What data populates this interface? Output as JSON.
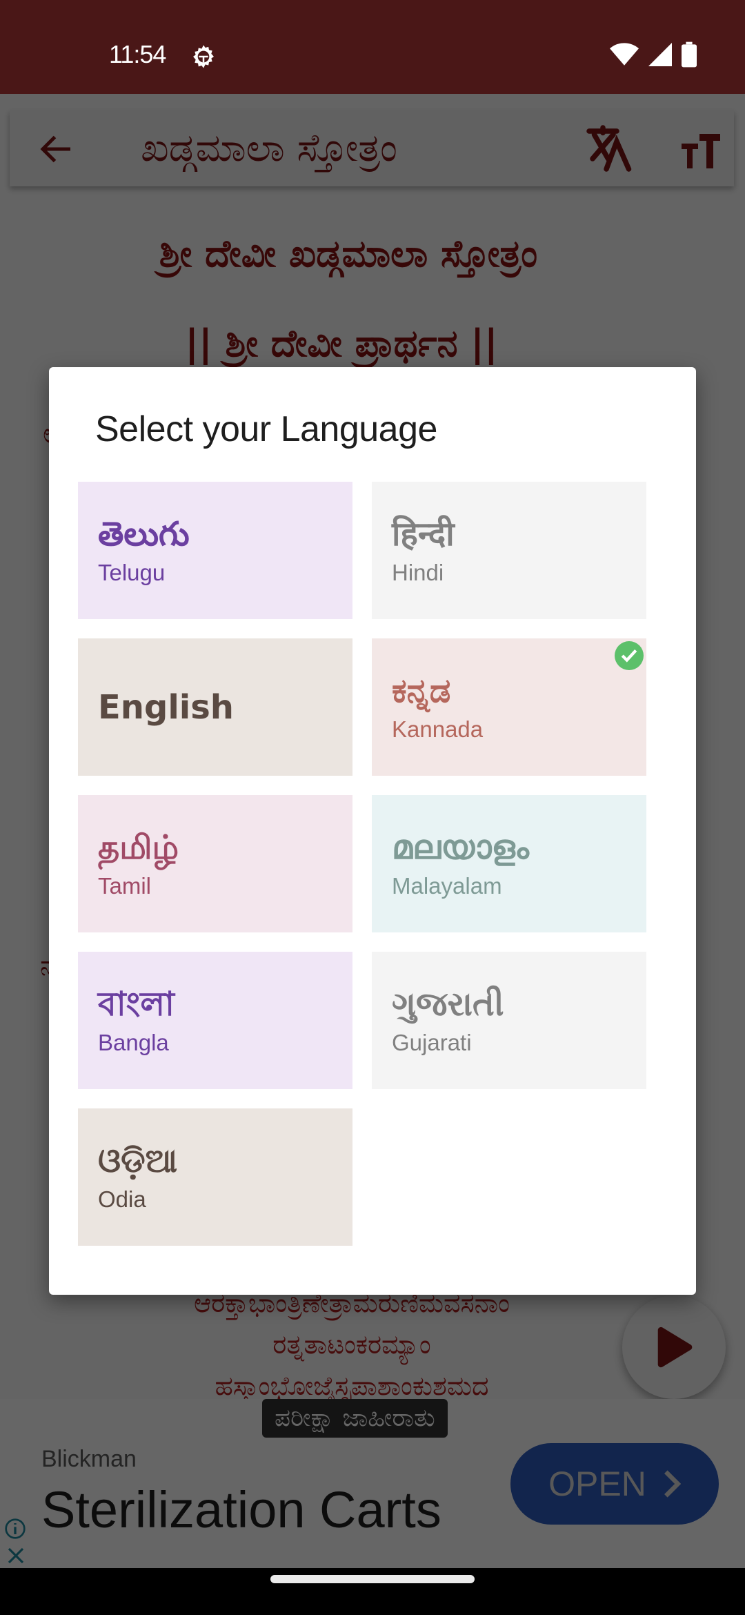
{
  "status_bar": {
    "time": "11:54",
    "icons": [
      "settings-gear-icon",
      "wifi-icon",
      "cellular-signal-icon",
      "battery-icon"
    ]
  },
  "toolbar": {
    "back_icon": "arrow-left-icon",
    "title": "ಖಡ್ಗಮಾಲಾ ಸ್ತೋತ್ರಂ",
    "translate_icon": "translate-icon",
    "font_size_icon": "text-size-icon"
  },
  "content": {
    "title": "ಶ್ರೀ ದೇವೀ ಖಡ್ಗಮಾಲಾ ಸ್ತೋತ್ರಂ",
    "subtitle": "|| ಶ್ರೀ ದೇವೀ ಪ್ರಾರ್ಥನ ||",
    "verses": [
      "ಆರಕ್ತಾಭಾಂತ್ರಿಣೇತ್ರಾಮರುಣಿಮವಸನಾಂ",
      "ರತ್ನತಾಟಂಕರಮ್ಯಾಂ",
      "ಹಸ್ತಾಂಭೋಜೈಸ್ಸಪಾಶಾಂಕುಶಮದ"
    ],
    "play_icon": "play-icon"
  },
  "ad": {
    "label": "ಪರೀಕ್ಷಾ ಜಾಹೀರಾತು",
    "brand": "Blickman",
    "headline": "Sterilization Carts",
    "cta": "OPEN",
    "cta_icon": "chevron-right-icon",
    "info_icon": "info-icon",
    "close_icon": "close-icon"
  },
  "dialog": {
    "title": "Select your Language",
    "selected": "Kannada",
    "languages": [
      {
        "native": "తెలుగు",
        "english": "Telugu",
        "bg": "#f0e6f6",
        "color": "#6b3fa0",
        "selected": false
      },
      {
        "native": "हिन्दी",
        "english": "Hindi",
        "bg": "#f4f4f4",
        "color": "#808080",
        "selected": false
      },
      {
        "native": "English",
        "english": "",
        "bg": "#ebe5e0",
        "color": "#5a4a42",
        "selected": false
      },
      {
        "native": "ಕನ್ನಡ",
        "english": "Kannada",
        "bg": "#f3e7e6",
        "color": "#b5675c",
        "selected": true
      },
      {
        "native": "தமிழ்",
        "english": "Tamil",
        "bg": "#f3e6ed",
        "color": "#a04a66",
        "selected": false
      },
      {
        "native": "മലയാളം",
        "english": "Malayalam",
        "bg": "#e8f3f4",
        "color": "#7e9a95",
        "selected": false
      },
      {
        "native": "বাংলা",
        "english": "Bangla",
        "bg": "#f0e6f6",
        "color": "#6b3fa0",
        "selected": false
      },
      {
        "native": "ગુજરાતી",
        "english": "Gujarati",
        "bg": "#f4f4f4",
        "color": "#808080",
        "selected": false
      },
      {
        "native": "ଓଡ଼ିଆ",
        "english": "Odia",
        "bg": "#ebe5e0",
        "color": "#5a4a42",
        "selected": false
      }
    ]
  },
  "colors": {
    "status_bar": "#4a1717",
    "accent": "#8b1212",
    "check": "#5cc06a",
    "ad_cta": "#2e5ec0"
  }
}
